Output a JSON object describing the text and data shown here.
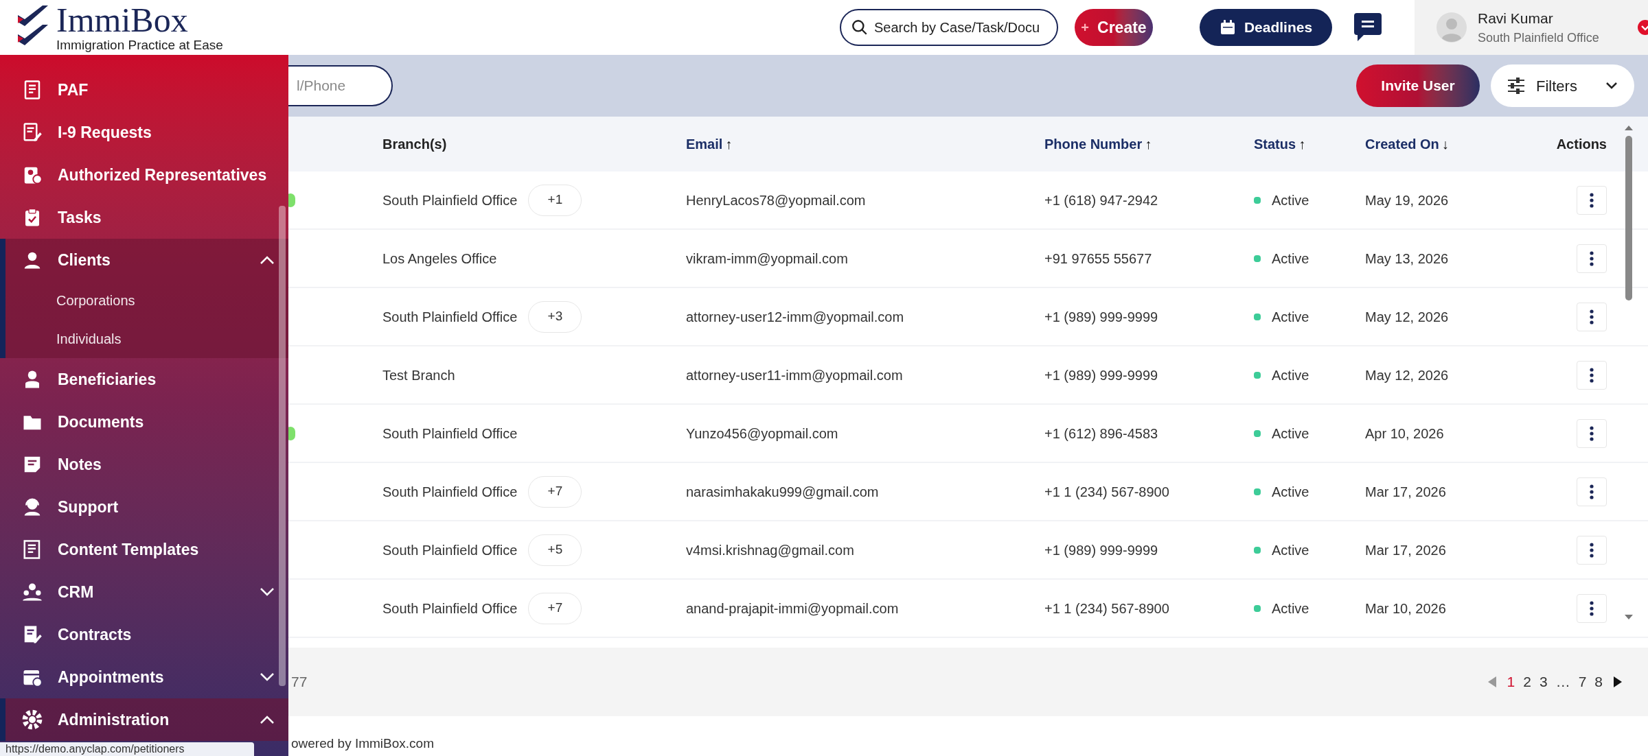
{
  "logo": {
    "name": "ImmiBox",
    "tagline": "Immigration Practice at Ease"
  },
  "topbar": {
    "search": {
      "placeholder": "Search by Case/Task/Docu"
    },
    "create_icon": "+",
    "create_button": "Create",
    "deadlines_button": "Deadlines",
    "user": {
      "name": "Ravi Kumar",
      "office": "South Plainfield Office"
    }
  },
  "sidebar": {
    "items": [
      {
        "label": "PAF",
        "kind": "link"
      },
      {
        "label": "I-9 Requests",
        "kind": "link"
      },
      {
        "label": "Authorized Representatives",
        "kind": "link"
      },
      {
        "label": "Tasks",
        "kind": "link"
      },
      {
        "label": "Clients",
        "kind": "group",
        "expanded": true,
        "children": [
          {
            "label": "Corporations"
          },
          {
            "label": "Individuals"
          }
        ]
      },
      {
        "label": "Beneficiaries",
        "kind": "link"
      },
      {
        "label": "Documents",
        "kind": "link"
      },
      {
        "label": "Notes",
        "kind": "link"
      },
      {
        "label": "Support",
        "kind": "link"
      },
      {
        "label": "Content Templates",
        "kind": "link"
      },
      {
        "label": "CRM",
        "kind": "group",
        "expanded": false
      },
      {
        "label": "Contracts",
        "kind": "link"
      },
      {
        "label": "Appointments",
        "kind": "group",
        "expanded": false
      },
      {
        "label": "Administration",
        "kind": "group",
        "expanded": true
      }
    ]
  },
  "status_link": "https://demo.anyclap.com/petitioners",
  "toolbar": {
    "search": {
      "placeholder": "l/Phone"
    },
    "invite_button": "Invite User",
    "filters_button": "Filters"
  },
  "table": {
    "columns": [
      {
        "label": "Branch(s)"
      },
      {
        "label": "Email",
        "arrow": "↑"
      },
      {
        "label": "Phone Number",
        "arrow": "↑"
      },
      {
        "label": "Status",
        "arrow": "↑"
      },
      {
        "label": "Created On",
        "arrow": "↓"
      },
      {
        "label": "Actions"
      }
    ],
    "rows": [
      {
        "online": true,
        "branch": "South Plainfield Office",
        "more": "+1",
        "email": "HenryLacos78@yopmail.com",
        "phone": "+1 (618) 947-2942",
        "status": "Active",
        "active": true,
        "created": "May 19, 2026"
      },
      {
        "online": false,
        "branch": "Los Angeles Office",
        "email": "vikram-imm@yopmail.com",
        "phone": "+91  97655 55677",
        "status": "Active",
        "active": true,
        "created": "May 13, 2026"
      },
      {
        "online": false,
        "branch": "South Plainfield Office",
        "more": "+3",
        "email": "attorney-user12-imm@yopmail.com",
        "phone": "+1 (989) 999-9999",
        "status": "Active",
        "active": true,
        "created": "May 12, 2026"
      },
      {
        "online": false,
        "branch": "Test Branch",
        "email": "attorney-user11-imm@yopmail.com",
        "phone": "+1 (989) 999-9999",
        "status": "Active",
        "active": true,
        "created": "May 12, 2026"
      },
      {
        "online": true,
        "branch": "South Plainfield Office",
        "email": "Yunzo456@yopmail.com",
        "phone": "+1 (612) 896-4583",
        "status": "Active",
        "active": true,
        "created": "Apr 10, 2026"
      },
      {
        "online": false,
        "branch": "South Plainfield Office",
        "more": "+7",
        "email": "narasimhakaku999@gmail.com",
        "phone": "+1 1 (234) 567-8900",
        "status": "Active",
        "active": true,
        "created": "Mar 17, 2026"
      },
      {
        "online": false,
        "branch": "South Plainfield Office",
        "more": "+5",
        "email": "v4msi.krishnag@gmail.com",
        "phone": "+1 (989) 999-9999",
        "status": "Active",
        "active": true,
        "created": "Mar 17, 2026"
      },
      {
        "online": false,
        "branch": "South Plainfield Office",
        "more": "+7",
        "email": "anand-prajapit-immi@yopmail.com",
        "phone": "+1 1 (234) 567-8900",
        "status": "Active",
        "active": true,
        "created": "Mar 10, 2026"
      }
    ]
  },
  "count_text": "77",
  "pagination": [
    {
      "label": "1",
      "selected": true
    },
    {
      "label": "2",
      "selected": false
    },
    {
      "label": "3",
      "selected": false
    },
    {
      "label": "…",
      "selected": false
    },
    {
      "label": "7",
      "selected": false
    },
    {
      "label": "8",
      "selected": false
    }
  ],
  "footer": "owered by ImmiBox.com"
}
